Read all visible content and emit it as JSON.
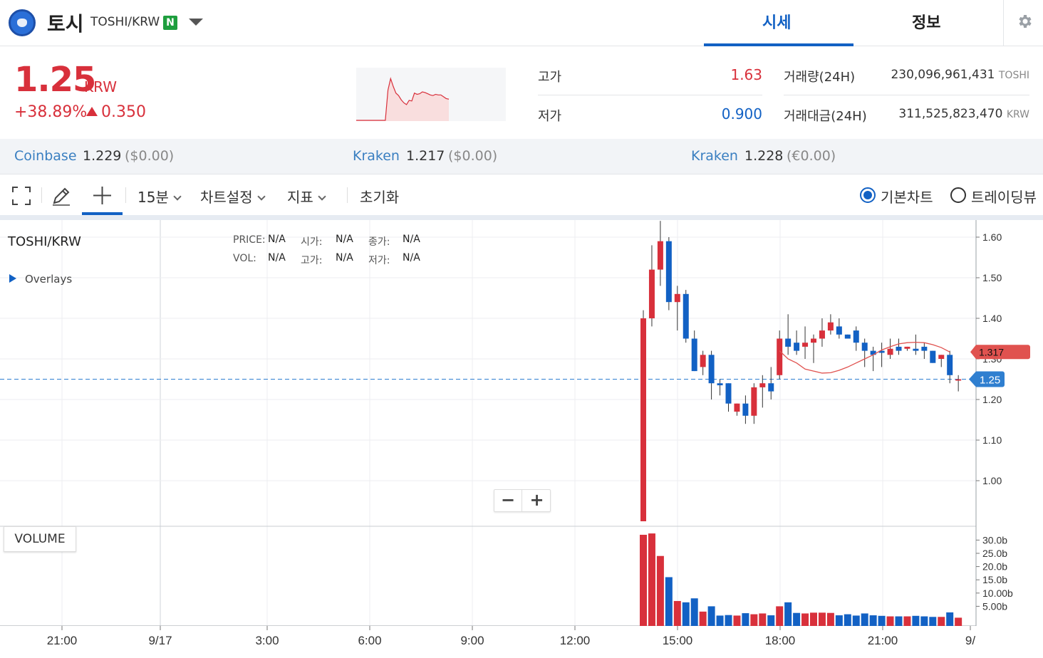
{
  "header": {
    "coin_name": "토시",
    "pair": "TOSHI/KRW",
    "badge": "N",
    "tabs": [
      {
        "label": "시세",
        "active": true
      },
      {
        "label": "정보",
        "active": false
      }
    ],
    "accent_color": "#1261c4"
  },
  "summary": {
    "price": "1.25",
    "price_unit": "KRW",
    "change_pct": "+38.89%",
    "change_abs": "0.350",
    "up_color": "#d8303b",
    "down_color": "#1261c4",
    "high_label": "고가",
    "high_value": "1.63",
    "low_label": "저가",
    "low_value": "0.900",
    "volume_label": "거래량(24H)",
    "volume_value": "230,096,961,431",
    "volume_unit": "TOSHI",
    "turnover_label": "거래대금(24H)",
    "turnover_value": "311,525,823,470",
    "turnover_unit": "KRW"
  },
  "exchanges": [
    {
      "name": "Coinbase",
      "price": "1.229",
      "converted": "($0.00)"
    },
    {
      "name": "Kraken",
      "price": "1.217",
      "converted": "($0.00)"
    },
    {
      "name": "Kraken",
      "price": "1.228",
      "converted": "(€0.00)"
    }
  ],
  "toolbar": {
    "interval": "15분",
    "chart_settings": "차트설정",
    "indicators": "지표",
    "reset": "초기화",
    "chart_modes": [
      {
        "label": "기본차트",
        "selected": true
      },
      {
        "label": "트레이딩뷰",
        "selected": false
      }
    ]
  },
  "chart": {
    "symbol": "TOSHI/KRW",
    "overlays_label": "Overlays",
    "legend": {
      "price_label": "PRICE:",
      "price_value": "N/A",
      "open_label": "시가:",
      "open_value": "N/A",
      "close_label": "종가:",
      "close_value": "N/A",
      "vol_label": "VOL:",
      "vol_value": "N/A",
      "high_label": "고가:",
      "high_value": "N/A",
      "low_label": "저가:",
      "low_value": "N/A"
    },
    "zoom_out": "−",
    "zoom_in": "+",
    "volume_label": "VOLUME",
    "ma_value_tag": "1.317",
    "current_price_tag": "1.25"
  },
  "chart_data": {
    "type": "candlestick",
    "price_ticks": [
      "1.60",
      "1.50",
      "1.40",
      "1.30",
      "1.20",
      "1.10",
      "1.00"
    ],
    "price_tick_values": [
      1.6,
      1.5,
      1.4,
      1.3,
      1.2,
      1.1,
      1.0
    ],
    "volume_ticks": [
      "30.0b",
      "25.0b",
      "20.0b",
      "15.0b",
      "10.00b",
      "5.00b"
    ],
    "volume_tick_values": [
      30,
      25,
      20,
      15,
      10,
      5
    ],
    "x_ticks": [
      "21:00",
      "9/17",
      "3:00",
      "6:00",
      "9:00",
      "12:00",
      "15:00",
      "18:00",
      "21:00",
      "9/"
    ],
    "current_price": 1.25,
    "ma_last": 1.317,
    "candles": [
      {
        "o": 0.9,
        "h": 1.42,
        "l": 0.9,
        "c": 1.4,
        "v": 32
      },
      {
        "o": 1.4,
        "h": 1.58,
        "l": 1.38,
        "c": 1.52,
        "v": 32.5
      },
      {
        "o": 1.52,
        "h": 1.64,
        "l": 1.48,
        "c": 1.59,
        "v": 24
      },
      {
        "o": 1.59,
        "h": 1.6,
        "l": 1.42,
        "c": 1.44,
        "v": 16
      },
      {
        "o": 1.44,
        "h": 1.48,
        "l": 1.37,
        "c": 1.46,
        "v": 7
      },
      {
        "o": 1.46,
        "h": 1.47,
        "l": 1.34,
        "c": 1.35,
        "v": 6.5
      },
      {
        "o": 1.35,
        "h": 1.37,
        "l": 1.27,
        "c": 1.27,
        "v": 8
      },
      {
        "o": 1.28,
        "h": 1.32,
        "l": 1.26,
        "c": 1.31,
        "v": 3
      },
      {
        "o": 1.31,
        "h": 1.32,
        "l": 1.2,
        "c": 1.24,
        "v": 5
      },
      {
        "o": 1.24,
        "h": 1.25,
        "l": 1.21,
        "c": 1.235,
        "v": 1.5
      },
      {
        "o": 1.24,
        "h": 1.24,
        "l": 1.17,
        "c": 1.19,
        "v": 1.7
      },
      {
        "o": 1.17,
        "h": 1.19,
        "l": 1.16,
        "c": 1.19,
        "v": 1.5
      },
      {
        "o": 1.19,
        "h": 1.21,
        "l": 1.14,
        "c": 1.16,
        "v": 2.4
      },
      {
        "o": 1.16,
        "h": 1.24,
        "l": 1.14,
        "c": 1.23,
        "v": 2.0
      },
      {
        "o": 1.23,
        "h": 1.26,
        "l": 1.18,
        "c": 1.24,
        "v": 2.3
      },
      {
        "o": 1.24,
        "h": 1.28,
        "l": 1.2,
        "c": 1.22,
        "v": 1.6
      },
      {
        "o": 1.26,
        "h": 1.37,
        "l": 1.25,
        "c": 1.35,
        "v": 5
      },
      {
        "o": 1.35,
        "h": 1.41,
        "l": 1.31,
        "c": 1.33,
        "v": 6.5
      },
      {
        "o": 1.34,
        "h": 1.37,
        "l": 1.31,
        "c": 1.32,
        "v": 2.5
      },
      {
        "o": 1.33,
        "h": 1.38,
        "l": 1.3,
        "c": 1.34,
        "v": 2.3
      },
      {
        "o": 1.34,
        "h": 1.36,
        "l": 1.29,
        "c": 1.35,
        "v": 2.6
      },
      {
        "o": 1.35,
        "h": 1.4,
        "l": 1.33,
        "c": 1.37,
        "v": 2.6
      },
      {
        "o": 1.37,
        "h": 1.41,
        "l": 1.36,
        "c": 1.39,
        "v": 2.5
      },
      {
        "o": 1.38,
        "h": 1.4,
        "l": 1.35,
        "c": 1.36,
        "v": 1.6
      },
      {
        "o": 1.36,
        "h": 1.36,
        "l": 1.35,
        "c": 1.35,
        "v": 2.0
      },
      {
        "o": 1.37,
        "h": 1.38,
        "l": 1.32,
        "c": 1.34,
        "v": 1.5
      },
      {
        "o": 1.34,
        "h": 1.35,
        "l": 1.28,
        "c": 1.32,
        "v": 2.3
      },
      {
        "o": 1.32,
        "h": 1.33,
        "l": 1.27,
        "c": 1.31,
        "v": 1.6
      },
      {
        "o": 1.32,
        "h": 1.34,
        "l": 1.28,
        "c": 1.315,
        "v": 1.4
      },
      {
        "o": 1.31,
        "h": 1.35,
        "l": 1.3,
        "c": 1.325,
        "v": 1.2
      },
      {
        "o": 1.33,
        "h": 1.35,
        "l": 1.31,
        "c": 1.32,
        "v": 1.2
      },
      {
        "o": 1.325,
        "h": 1.33,
        "l": 1.32,
        "c": 1.33,
        "v": 1.2
      },
      {
        "o": 1.325,
        "h": 1.36,
        "l": 1.31,
        "c": 1.32,
        "v": 1.4
      },
      {
        "o": 1.33,
        "h": 1.34,
        "l": 1.3,
        "c": 1.32,
        "v": 1.2
      },
      {
        "o": 1.32,
        "h": 1.32,
        "l": 1.29,
        "c": 1.29,
        "v": 1.0
      },
      {
        "o": 1.3,
        "h": 1.31,
        "l": 1.28,
        "c": 1.31,
        "v": 1.0
      },
      {
        "o": 1.31,
        "h": 1.32,
        "l": 1.24,
        "c": 1.26,
        "v": 2.7
      },
      {
        "o": 1.25,
        "h": 1.26,
        "l": 1.22,
        "c": 1.25,
        "v": 0.7
      }
    ],
    "ma": [
      [
        17,
        1.32
      ],
      [
        18,
        1.3
      ],
      [
        19,
        1.29
      ],
      [
        20,
        1.275
      ],
      [
        21,
        1.27
      ],
      [
        22,
        1.265
      ],
      [
        23,
        1.266
      ],
      [
        24,
        1.272
      ],
      [
        25,
        1.28
      ],
      [
        26,
        1.29
      ],
      [
        27,
        1.3
      ],
      [
        28,
        1.31
      ],
      [
        29,
        1.322
      ],
      [
        30,
        1.33
      ],
      [
        31,
        1.337
      ],
      [
        32,
        1.34
      ],
      [
        33,
        1.341
      ],
      [
        34,
        1.34
      ],
      [
        35,
        1.335
      ],
      [
        36,
        1.328
      ],
      [
        37,
        1.317
      ]
    ],
    "mini_series": [
      0.9,
      0.9,
      0.9,
      0.9,
      0.9,
      0.9,
      0.9,
      0.9,
      0.9,
      0.9,
      0.9,
      0.9,
      1.4,
      1.59,
      1.46,
      1.35,
      1.31,
      1.24,
      1.19,
      1.16,
      1.23,
      1.22,
      1.35,
      1.33,
      1.34,
      1.37,
      1.36,
      1.34,
      1.32,
      1.31,
      1.33,
      1.32,
      1.32,
      1.29,
      1.26,
      1.25
    ]
  }
}
